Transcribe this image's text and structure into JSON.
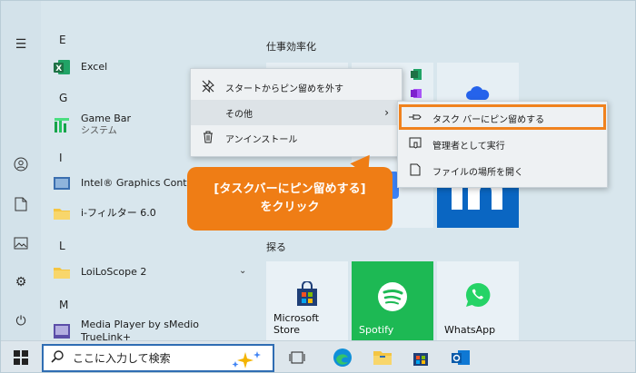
{
  "applist": {
    "letters": [
      "E",
      "G",
      "I",
      "L",
      "M"
    ],
    "apps": [
      {
        "label": "Excel",
        "sub": ""
      },
      {
        "label": "Game Bar",
        "sub": "システム"
      },
      {
        "label": "Intel® Graphics Control P",
        "sub": ""
      },
      {
        "label": "i-フィルター 6.0",
        "sub": ""
      },
      {
        "label": "LoiLoScope 2",
        "sub": ""
      },
      {
        "label": "Media Player by sMedio TrueLink+",
        "sub": ""
      }
    ]
  },
  "tiles": {
    "group1_title": "仕事効率化",
    "group2_title": "探る",
    "store_label": "Microsoft Store",
    "spotify_label": "Spotify",
    "whatsapp_label": "WhatsApp"
  },
  "context_menu": {
    "unpin": "スタートからピン留めを外す",
    "more": "その他",
    "uninstall": "アンインストール"
  },
  "submenu": {
    "pin_taskbar": "タスク バーにピン留めする",
    "run_admin": "管理者として実行",
    "open_location": "ファイルの場所を開く"
  },
  "callout": {
    "line1": "[タスクバーにピン留めする]",
    "line2": "をクリック"
  },
  "taskbar": {
    "search_placeholder": "ここに入力して検索"
  },
  "colors": {
    "accent_orange": "#f0821e",
    "callout_bg": "#ef7d15",
    "spotify_green": "#1db954",
    "excel_green": "#1e7145",
    "linkedin_blue": "#0a66c2",
    "search_border": "#2f6db3"
  }
}
